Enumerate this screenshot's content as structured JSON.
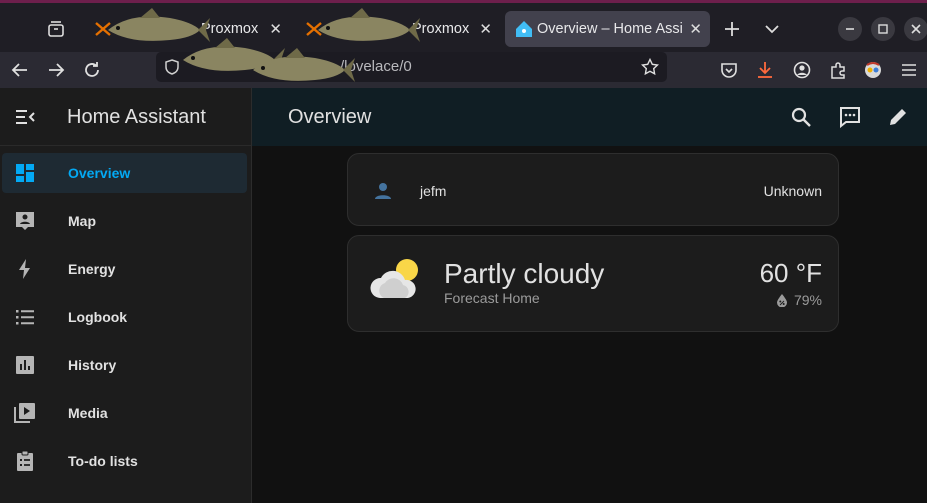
{
  "browser": {
    "tabs": [
      {
        "label": "Proxmox"
      },
      {
        "label": "Proxmox"
      },
      {
        "label": "Overview – Home Assi"
      }
    ],
    "url_fragment": "/lovelace/0"
  },
  "sidebar": {
    "title": "Home Assistant",
    "items": [
      {
        "label": "Overview",
        "icon": "dashboard-icon"
      },
      {
        "label": "Map",
        "icon": "map-account-icon"
      },
      {
        "label": "Energy",
        "icon": "lightning-icon"
      },
      {
        "label": "Logbook",
        "icon": "list-icon"
      },
      {
        "label": "History",
        "icon": "chart-bar-icon"
      },
      {
        "label": "Media",
        "icon": "play-box-icon"
      },
      {
        "label": "To-do lists",
        "icon": "clipboard-list-icon"
      }
    ]
  },
  "header": {
    "title": "Overview"
  },
  "person_card": {
    "name": "jefm",
    "state": "Unknown"
  },
  "weather_card": {
    "condition": "Partly cloudy",
    "name": "Forecast Home",
    "temperature": "60 °F",
    "humidity": "79%"
  },
  "colors": {
    "accent": "#03a9f4",
    "sun": "#f9d648"
  }
}
